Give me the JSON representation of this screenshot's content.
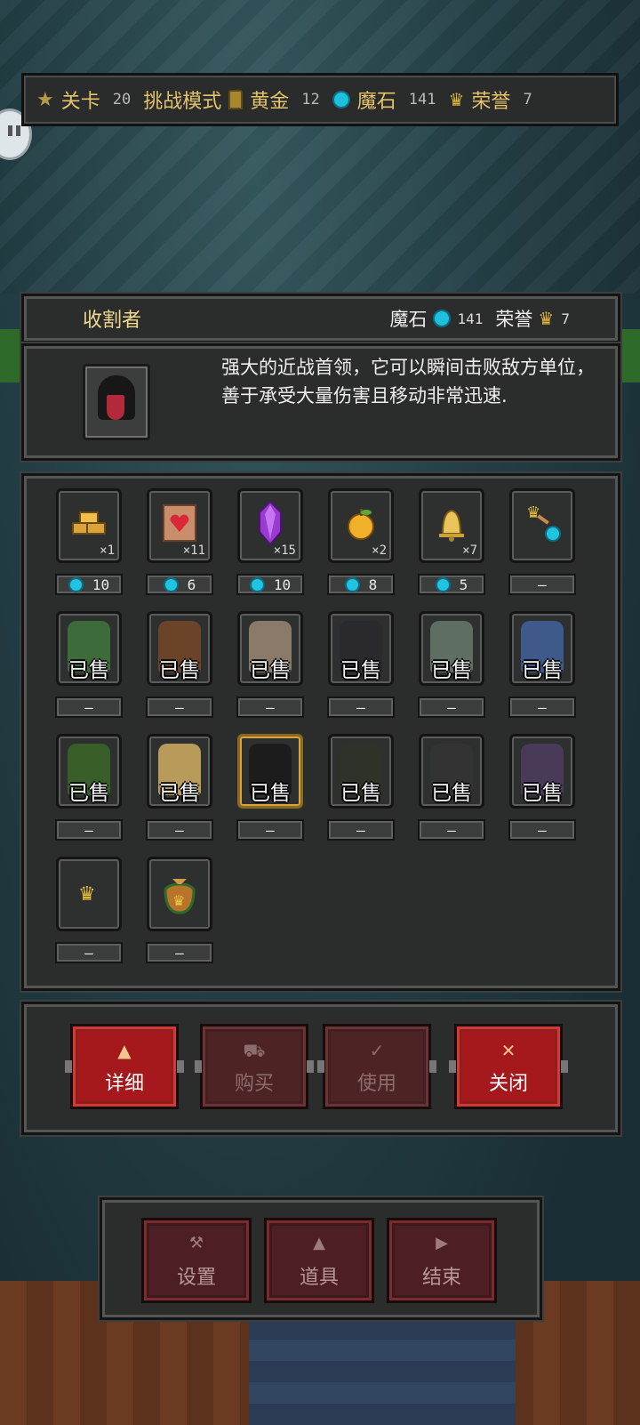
{
  "topbar": {
    "level_label": "关卡",
    "level_value": "20",
    "mode": "挑战模式",
    "gold_label": "黄金",
    "gold_value": "12",
    "stone_label": "魔石",
    "stone_value": "141",
    "honor_label": "荣誉",
    "honor_value": "7"
  },
  "header": {
    "title": "收割者",
    "stone_label": "魔石",
    "stone_value": "141",
    "honor_label": "荣誉",
    "honor_value": "7"
  },
  "description": "强大的近战首领，它可以瞬间击败敌方单位，善于承受大量伤害且移动非常迅速.",
  "items": [
    {
      "icon": "gold-bars-icon",
      "count": "×1",
      "price": "10",
      "sold": false
    },
    {
      "icon": "heart-scroll-icon",
      "count": "×11",
      "price": "6",
      "sold": false
    },
    {
      "icon": "purple-crystal-icon",
      "count": "×15",
      "price": "10",
      "sold": false
    },
    {
      "icon": "golden-apple-icon",
      "count": "×2",
      "price": "8",
      "sold": false
    },
    {
      "icon": "bell-icon",
      "count": "×7",
      "price": "5",
      "sold": false
    },
    {
      "icon": "crown-to-stone-icon",
      "count": "",
      "price": "—",
      "sold": false
    },
    {
      "icon": "green-slime-icon",
      "count": "",
      "price": "—",
      "sold": true,
      "color": "#3e6b3a"
    },
    {
      "icon": "treant-icon",
      "count": "",
      "price": "—",
      "sold": true,
      "color": "#6b4328"
    },
    {
      "icon": "spartan-warrior-icon",
      "count": "",
      "price": "—",
      "sold": true,
      "color": "#8a7a6a"
    },
    {
      "icon": "dark-sorcerer-icon",
      "count": "",
      "price": "—",
      "sold": true,
      "color": "#2a2a2e"
    },
    {
      "icon": "zombie-icon",
      "count": "",
      "price": "—",
      "sold": true,
      "color": "#5e6e62"
    },
    {
      "icon": "blue-mage-icon",
      "count": "",
      "price": "—",
      "sold": true,
      "color": "#3d5a8a"
    },
    {
      "icon": "forest-guardian-icon",
      "count": "",
      "price": "—",
      "sold": true,
      "color": "#3a5e2a"
    },
    {
      "icon": "blonde-girl-icon",
      "count": "",
      "price": "—",
      "sold": true,
      "color": "#b89a5a"
    },
    {
      "icon": "reaper-icon",
      "count": "",
      "price": "—",
      "sold": true,
      "color": "#1c1c1c",
      "selected": true
    },
    {
      "icon": "hooded-mage-icon",
      "count": "",
      "price": "—",
      "sold": true,
      "color": "#2e3228"
    },
    {
      "icon": "crossed-swords-icon",
      "count": "",
      "price": "—",
      "sold": true,
      "color": "#333"
    },
    {
      "icon": "hourglass-icon",
      "count": "",
      "price": "—",
      "sold": true,
      "color": "#4a3a5a"
    },
    {
      "icon": "crown-icon",
      "count": "",
      "price": "—",
      "sold": false
    },
    {
      "icon": "coin-bag-icon",
      "count": "",
      "price": "—",
      "sold": false
    }
  ],
  "sold_label": "已售",
  "actions": {
    "details": "详细",
    "buy": "购买",
    "use": "使用",
    "close": "关闭"
  },
  "bottom": {
    "settings": "设置",
    "items": "道具",
    "end": "结束"
  }
}
